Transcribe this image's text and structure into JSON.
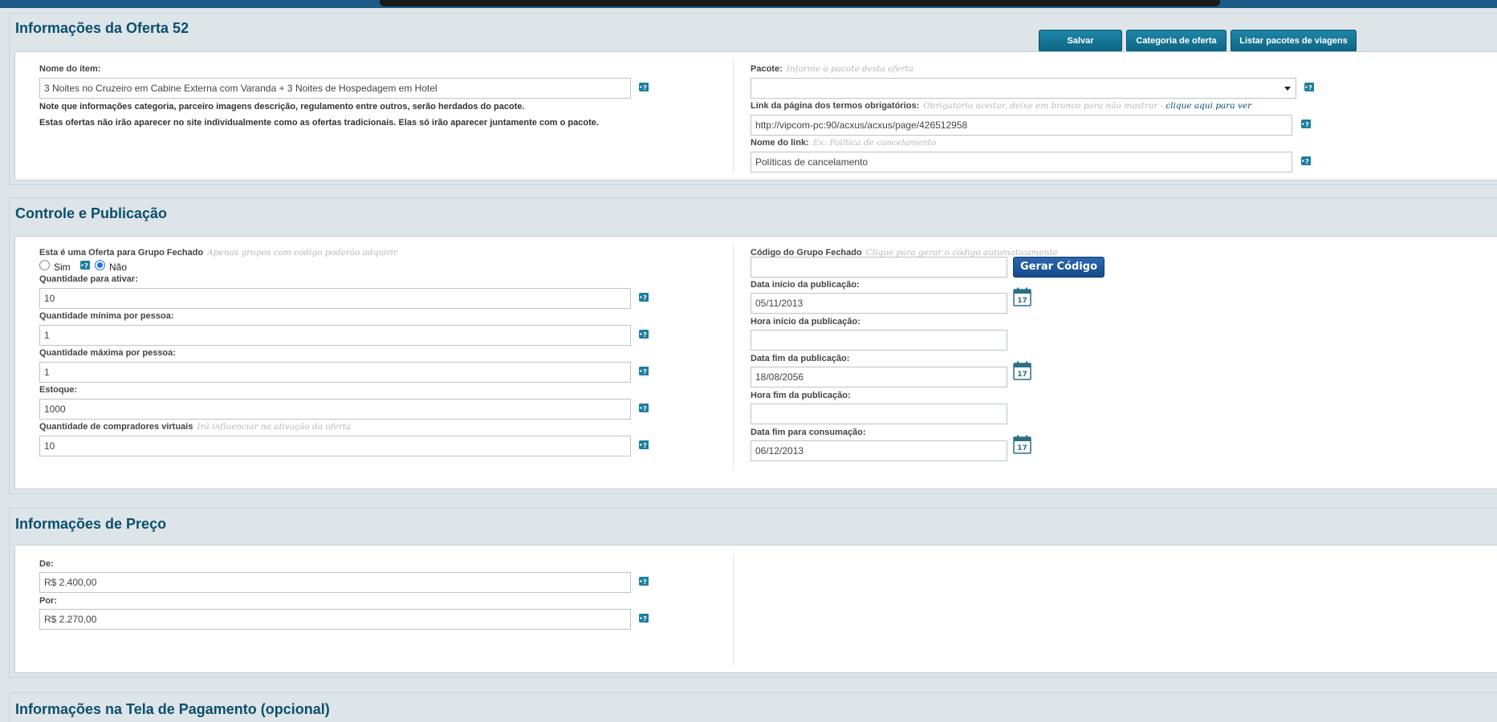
{
  "colors": {
    "accent": "#0b4f6c",
    "button": "#0e6584",
    "generate_button": "#164a8a",
    "background": "#dfe6ea"
  },
  "header": {
    "title": "Informações da Oferta 52",
    "buttons": {
      "save": "Salvar",
      "category": "Categoria de oferta",
      "list_packages": "Listar pacotes de viagens"
    }
  },
  "offer": {
    "item_name_label": "Nome do item:",
    "item_name_value": "3 Noites no Cruzeiro em Cabine Externa com Varanda + 3 Noites de Hospedagem em Hotel",
    "note1": "Note que informações categoria, parceiro imagens descrição, regulamento entre outros, serão herdados do pacote.",
    "note2": "Estas ofertas não irão aparecer no site individualmente como as ofertas tradicionais. Elas só irão aparecer juntamente com o pacote.",
    "package_label": "Pacote:",
    "package_hint": "Informe o pacote desta oferta",
    "package_value": "",
    "terms_label": "Link da página dos termos obrigatórios:",
    "terms_hint": "Obrigatório aceitar, deixe em branco para não mostrar -",
    "terms_link": "clique aqui para ver",
    "terms_value": "http://vipcom-pc:90/acxus/acxus/page/426512958",
    "link_name_label": "Nome do link:",
    "link_name_hint": "Ex: Política de cancelamento",
    "link_name_value": "Políticas de cancelamento"
  },
  "control": {
    "title": "Controle e Publicação",
    "closed_group_label": "Esta é uma Oferta para Grupo Fechado",
    "closed_group_hint": "Apenas grupos com código poderão adquirir",
    "radio_yes": "Sim",
    "radio_no": "Não",
    "selected": "Não",
    "qty_activate_label": "Quantidade para ativar:",
    "qty_activate_value": "10",
    "qty_min_label": "Quantidade mínima por pessoa:",
    "qty_min_value": "1",
    "qty_max_label": "Quantidade máxima por pessoa:",
    "qty_max_value": "1",
    "stock_label": "Estoque:",
    "stock_value": "1000",
    "virtual_buyers_label": "Quantidade de compradores virtuais",
    "virtual_buyers_hint": "Irá influenciar na ativação da oferta",
    "virtual_buyers_value": "10",
    "group_code_label": "Código do Grupo Fechado",
    "group_code_hint": "Clique para gerar o código automaticamente",
    "group_code_value": "",
    "generate_button": "Gerar Código",
    "pub_start_label": "Data início da publicação:",
    "pub_start_value": "05/11/2013",
    "pub_start_time_label": "Hora início da publicação:",
    "pub_start_time_value": "",
    "pub_end_label": "Data fim da publicação:",
    "pub_end_value": "18/08/2056",
    "pub_end_time_label": "Hora fim da publicação:",
    "pub_end_time_value": "",
    "consume_end_label": "Data fim para consumação:",
    "consume_end_value": "06/12/2013",
    "calendar_day": "17"
  },
  "price": {
    "title": "Informações de Preço",
    "from_label": "De:",
    "from_value": "R$ 2.400,00",
    "to_label": "Por:",
    "to_value": "R$ 2.270,00"
  },
  "payment": {
    "title": "Informações na Tela de Pagamento (opcional)"
  }
}
